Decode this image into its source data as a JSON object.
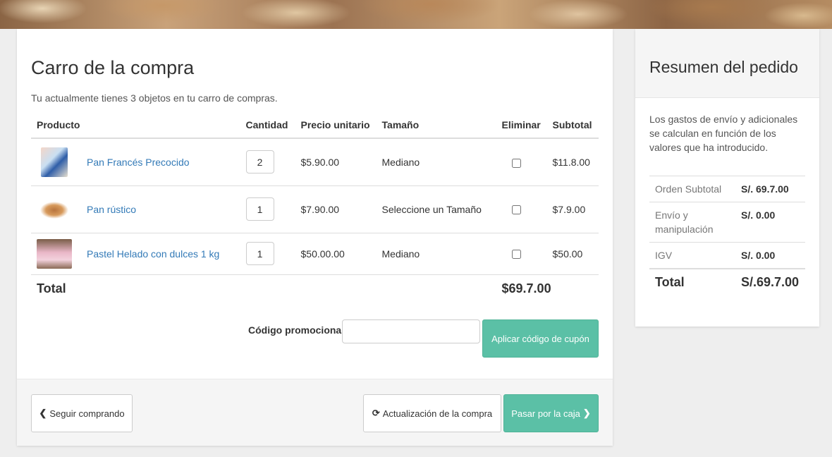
{
  "cart": {
    "title": "Carro de la compra",
    "subtitle": "Tu actualmente tienes 3 objetos en tu carro de compras.",
    "columns": [
      "Producto",
      "Cantidad",
      "Precio unitario",
      "Tamaño",
      "Eliminar",
      "Subtotal"
    ],
    "items": [
      {
        "name": "Pan Francés Precocido",
        "qty": "2",
        "price": "$5.90.00",
        "size": "Mediano",
        "subtotal": "$11.8.00"
      },
      {
        "name": "Pan rústico",
        "qty": "1",
        "price": "$7.90.00",
        "size": "Seleccione un Tamaño",
        "subtotal": "$7.9.00"
      },
      {
        "name": "Pastel Helado con dulces 1 kg",
        "qty": "1",
        "price": "$50.00.00",
        "size": "Mediano",
        "subtotal": "$50.00"
      }
    ],
    "total_label": "Total",
    "total_value": "$69.7.00",
    "promo_label": "Código promocional:",
    "promo_value": "",
    "promo_button": "Aplicar código de cupón",
    "back_button": "Seguir comprando",
    "update_button": "Actualización de la compra",
    "checkout_button": "Pasar por la caja"
  },
  "summary": {
    "title": "Resumen del pedido",
    "note": "Los gastos de envío y adicionales se calculan en función de los valores que ha introducido.",
    "rows": [
      {
        "label": "Orden Subtotal",
        "value": "S/. 69.7.00"
      },
      {
        "label": "Envío y manipulación",
        "value": "S/. 0.00"
      },
      {
        "label": "IGV",
        "value": "S/. 0.00"
      }
    ],
    "total_label": "Total",
    "total_value": "S/.69.7.00"
  },
  "icons": {
    "back": "chevron-left-icon",
    "update": "refresh-icon",
    "checkout": "chevron-right-icon"
  },
  "colors": {
    "accent": "#5bc0a6",
    "link": "#337ab7"
  }
}
